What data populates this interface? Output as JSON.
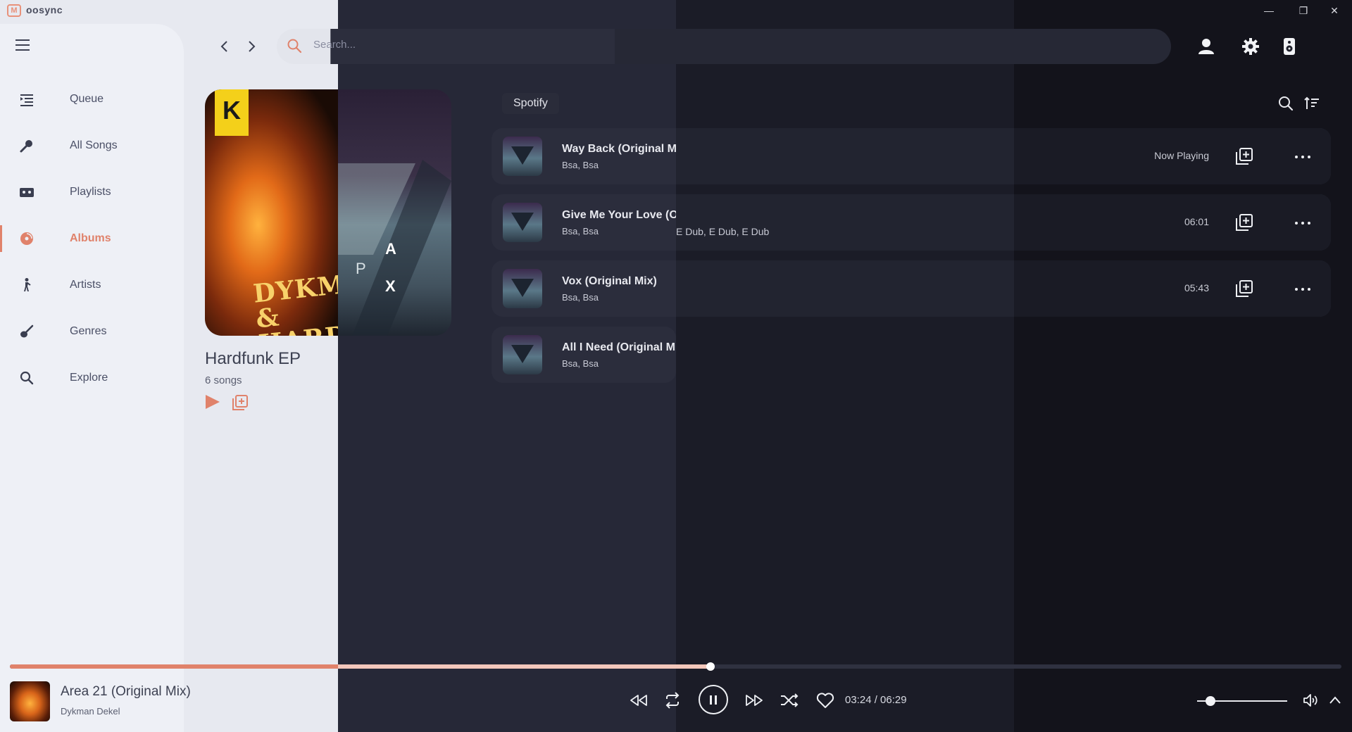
{
  "app": {
    "title": "oosync",
    "logo_glyph": "M"
  },
  "window_controls": {
    "minimize": "—",
    "restore": "❐",
    "close": "✕"
  },
  "sidebar": {
    "items": [
      {
        "label": "Queue",
        "icon": "queue-icon"
      },
      {
        "label": "All Songs",
        "icon": "microphone-icon"
      },
      {
        "label": "Playlists",
        "icon": "cassette-icon"
      },
      {
        "label": "Albums",
        "icon": "disc-icon",
        "active": true
      },
      {
        "label": "Artists",
        "icon": "person-icon"
      },
      {
        "label": "Genres",
        "icon": "guitar-icon"
      },
      {
        "label": "Explore",
        "icon": "search-icon"
      }
    ]
  },
  "search": {
    "placeholder": "Search..."
  },
  "album": {
    "title": "Hardfunk EP",
    "song_count": "6 songs",
    "art_text_left": "DYKMAN & HARDFUI",
    "art_letters": [
      "A",
      "P",
      "X"
    ]
  },
  "tracklist": {
    "source": "Spotify",
    "tracks": [
      {
        "title": "Way Back (Original Mi",
        "artist": "Bsa, Bsa",
        "extra": "",
        "status": "Now Playing"
      },
      {
        "title": "Give Me Your Love (Or",
        "artist": "Bsa, Bsa",
        "extra": "E Dub, E Dub, E Dub",
        "status": "06:01"
      },
      {
        "title": "Vox (Original Mix)",
        "artist": "Bsa, Bsa",
        "extra": "",
        "status": "05:43"
      },
      {
        "title": "All I Need (Original Mi",
        "artist": "Bsa, Bsa",
        "extra": "",
        "status": ""
      }
    ]
  },
  "player": {
    "title": "Area 21 (Original Mix)",
    "artist": "Dykman Dekel",
    "time": "03:24 / 06:29",
    "progress_fraction": 0.526,
    "volume_fraction": 0.15
  },
  "colors": {
    "accent": "#e0826b",
    "accent_light": "#f3c7bb",
    "light_panel": "#eef0f6",
    "dark_panel": "#262837"
  }
}
